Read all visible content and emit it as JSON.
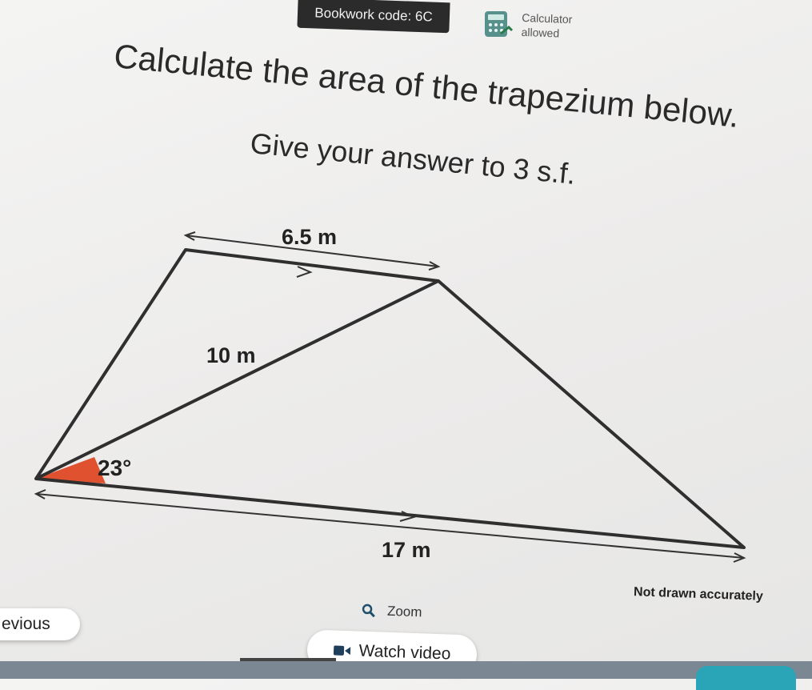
{
  "header": {
    "bookwork_code": "Bookwork code: 6C",
    "calculator_line1": "Calculator",
    "calculator_line2": "allowed"
  },
  "question": {
    "prompt": "Calculate the area of the trapezium below.",
    "instruction": "Give your answer to 3 s.f."
  },
  "diagram": {
    "top_label": "6.5 m",
    "diagonal_label": "10 m",
    "angle_label": "23°",
    "bottom_label": "17 m",
    "note": "Not drawn accurately",
    "angle_color": "#e0522f"
  },
  "controls": {
    "zoom_label": "Zoom",
    "previous_label": "evious",
    "video_label": "Watch video"
  }
}
